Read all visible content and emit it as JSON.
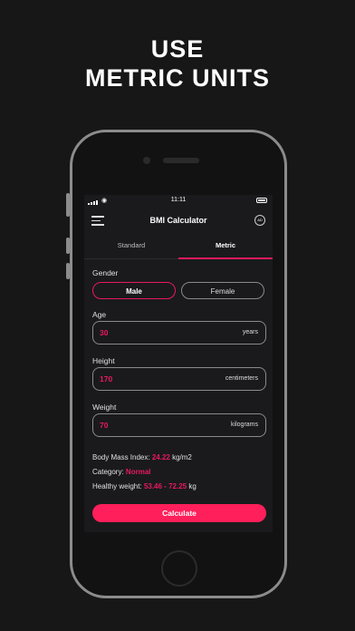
{
  "promo": {
    "line1": "USE",
    "line2": "METRIC UNITS"
  },
  "status": {
    "time": "11:11"
  },
  "header": {
    "title": "BMI Calculator",
    "ad_label": "AD"
  },
  "tabs": [
    {
      "label": "Standard"
    },
    {
      "label": "Metric"
    }
  ],
  "gender": {
    "label": "Gender",
    "options": [
      "Male",
      "Female"
    ],
    "selected": "Male"
  },
  "age": {
    "label": "Age",
    "value": "30",
    "unit": "years"
  },
  "height": {
    "label": "Height",
    "value": "170",
    "unit": "centimeters"
  },
  "weight": {
    "label": "Weight",
    "value": "70",
    "unit": "kilograms"
  },
  "results": {
    "bmi_label": "Body Mass Index:",
    "bmi_value": "24.22",
    "bmi_unit": "kg/m2",
    "category_label": "Category:",
    "category_value": "Normal",
    "healthy_label": "Healthy weight:",
    "healthy_value": "53.46 - 72.25",
    "healthy_unit": "kg"
  },
  "actions": {
    "calculate": "Calculate"
  },
  "colors": {
    "accent": "#e8195f",
    "button": "#ff1f5a",
    "background": "#171717"
  }
}
